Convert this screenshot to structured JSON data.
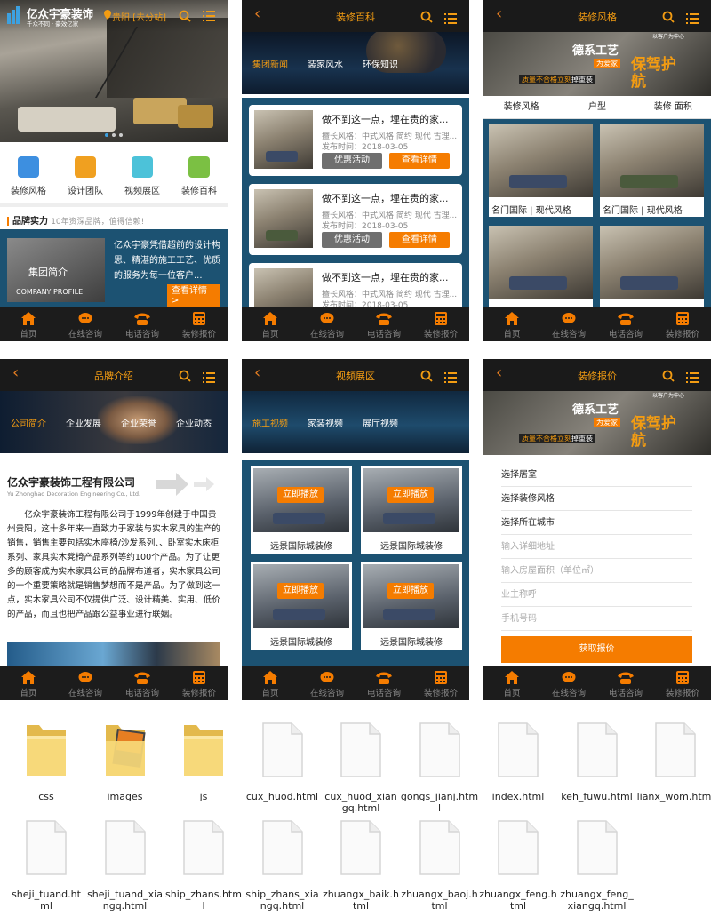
{
  "tabbar": [
    "首页",
    "在线咨询",
    "电话咨询",
    "装修报价"
  ],
  "s1": {
    "brand": "亿众宇豪装饰",
    "slogan": "千众不同 · 豪效亿家",
    "city": "贵阳 [去分站]",
    "icons": [
      {
        "label": "装修风格",
        "icon": "phone-icon",
        "color": "#3d8fe0"
      },
      {
        "label": "设计团队",
        "icon": "team-icon",
        "color": "#f0a020"
      },
      {
        "label": "视频展区",
        "icon": "video-icon",
        "color": "#4cc2d9"
      },
      {
        "label": "装修百科",
        "icon": "book-icon",
        "color": "#7bc043"
      }
    ],
    "section_title": "品牌实力",
    "section_sub": "10年资深品牌，值得信赖!",
    "intro_title": "集团简介",
    "intro_en": "COMPANY PROFILE",
    "intro_text": "亿众宇豪凭借超前的设计构思、精湛的施工工艺、优质的服务为每一位客户...",
    "intro_btn": "查看详情 >"
  },
  "s2": {
    "title": "装修百科",
    "tabs": [
      "集团新闻",
      "装家风水",
      "环保知识"
    ],
    "news_title": "做不到这一点，埋在贵的家...",
    "style_line": "擅长风格：中式风格 简约 现代 古理...",
    "date_line": "发布时间：2018-03-05",
    "btn_promo": "优惠活动",
    "btn_detail": "查看详情"
  },
  "s3": {
    "title": "装修风格",
    "banner_t1": "德系工艺",
    "banner_t2": "为爱家",
    "banner_t3": "保驾护航",
    "banner_t4": "质量不合格立刻",
    "banner_t5": "掉重装",
    "banner_corner": "以客户为中心",
    "filters": [
      "装修风格",
      "户型",
      "装修 面积"
    ],
    "caption": "名门国际 | 现代风格"
  },
  "s4": {
    "title": "品牌介绍",
    "tabs": [
      "公司简介",
      "企业发展",
      "企业荣誉",
      "企业动态"
    ],
    "company": "亿众宇豪装饰工程有限公司",
    "company_en": "Yu Zhonghao Decoration Engineering Co., Ltd.",
    "body": "亿众宇豪装饰工程有限公司于1999年创建于中国贵州贵阳，这十多年来一直致力于家装与实木家具的生产的销售，销售主要包括实木座椅/沙发系列、、卧室实木床柜系列、家具实木凳椅产品系列等约100个产品。为了让更多的顾客成为实木家具公司的品牌布道者，实木家具公司的一个重要策略就是销售梦想而不是产品。为了做到这一点，实木家具公司不仅提供广泛、设计精美、实用、低价的产品，而且也把产品跟公益事业进行联姻。"
  },
  "s5": {
    "title": "视频展区",
    "tabs": [
      "施工视频",
      "家装视频",
      "展厅视频"
    ],
    "play": "立即播放",
    "caption": "远景国际城装修"
  },
  "s6": {
    "title": "装修报价",
    "fields": [
      "选择居室",
      "选择装修风格",
      "选择所在城市"
    ],
    "placeholders": [
      "输入详细地址",
      "输入房屋面积（单位㎡）",
      "业主称呼",
      "手机号码"
    ],
    "submit": "获取报价"
  },
  "files": [
    {
      "name": "css",
      "kind": "folder"
    },
    {
      "name": "images",
      "kind": "folder-img"
    },
    {
      "name": "js",
      "kind": "folder"
    },
    {
      "name": "cux_huod.html",
      "kind": "file"
    },
    {
      "name": "cux_huod_xiangq.html",
      "kind": "file"
    },
    {
      "name": "gongs_jianj.html",
      "kind": "file"
    },
    {
      "name": "index.html",
      "kind": "file"
    },
    {
      "name": "keh_fuwu.html",
      "kind": "file"
    },
    {
      "name": "lianx_wom.html",
      "kind": "file"
    },
    {
      "name": "sheji_tuand.html",
      "kind": "file"
    },
    {
      "name": "sheji_tuand_xiangq.html",
      "kind": "file"
    },
    {
      "name": "ship_zhans.html",
      "kind": "file"
    },
    {
      "name": "ship_zhans_xiangq.html",
      "kind": "file"
    },
    {
      "name": "zhuangx_baik.html",
      "kind": "file"
    },
    {
      "name": "zhuangx_baoj.html",
      "kind": "file"
    },
    {
      "name": "zhuangx_feng.html",
      "kind": "file"
    },
    {
      "name": "zhuangx_feng_xiangq.html",
      "kind": "file"
    }
  ]
}
